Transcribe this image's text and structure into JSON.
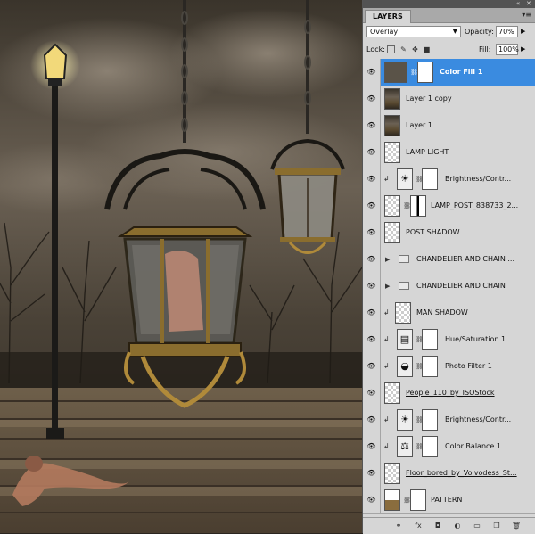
{
  "panel": {
    "tab_label": "LAYERS",
    "menu_icon": "panel-menu-icon",
    "window_controls": [
      "«",
      "✕"
    ],
    "blend_mode": "Overlay",
    "opacity_label": "Opacity:",
    "opacity_value": "70%",
    "lock_label": "Lock:",
    "lock_icons": [
      "lock-transparency-icon",
      "lock-image-icon",
      "lock-position-icon",
      "lock-all-icon"
    ],
    "fill_label": "Fill:",
    "fill_value": "100%"
  },
  "layers": [
    {
      "name": "Color Fill 1",
      "type": "fill",
      "selected": true,
      "clipped": false,
      "underline": false
    },
    {
      "name": "Layer 1 copy",
      "type": "image",
      "selected": false,
      "clipped": false,
      "underline": false
    },
    {
      "name": "Layer 1",
      "type": "image",
      "selected": false,
      "clipped": false,
      "underline": false
    },
    {
      "name": "LAMP LIGHT",
      "type": "pixel",
      "selected": false,
      "clipped": false,
      "underline": false
    },
    {
      "name": "Brightness/Contr...",
      "type": "adjust-brightness",
      "selected": false,
      "clipped": true,
      "underline": false
    },
    {
      "name": "LAMP_POST_838733_2...",
      "type": "smart",
      "selected": false,
      "clipped": false,
      "underline": true
    },
    {
      "name": "POST SHADOW",
      "type": "pixel",
      "selected": false,
      "clipped": false,
      "underline": false
    },
    {
      "name": "CHANDELIER AND CHAIN ...",
      "type": "group",
      "selected": false,
      "clipped": false,
      "underline": false
    },
    {
      "name": "CHANDELIER AND CHAIN",
      "type": "group",
      "selected": false,
      "clipped": false,
      "underline": false
    },
    {
      "name": "MAN SHADOW",
      "type": "pixel",
      "selected": false,
      "clipped": true,
      "underline": false
    },
    {
      "name": "Hue/Saturation 1",
      "type": "adjust-hue",
      "selected": false,
      "clipped": true,
      "underline": false
    },
    {
      "name": "Photo Filter 1",
      "type": "adjust-photo",
      "selected": false,
      "clipped": true,
      "underline": false
    },
    {
      "name": "People_110_by_ISOStock",
      "type": "pixel",
      "selected": false,
      "clipped": false,
      "underline": true
    },
    {
      "name": "Brightness/Contr...",
      "type": "adjust-brightness",
      "selected": false,
      "clipped": true,
      "underline": false
    },
    {
      "name": "Color Balance 1",
      "type": "adjust-balance",
      "selected": false,
      "clipped": true,
      "underline": false
    },
    {
      "name": "Floor_bored_by_Voivodess_St...",
      "type": "pixel",
      "selected": false,
      "clipped": false,
      "underline": true
    },
    {
      "name": "PATTERN",
      "type": "pattern",
      "selected": false,
      "clipped": false,
      "underline": false
    }
  ],
  "bottom_icons": [
    "link-layers-icon",
    "fx-icon",
    "add-mask-icon",
    "adjustment-layer-icon",
    "new-group-icon",
    "new-layer-icon",
    "trash-icon"
  ],
  "bottom_icon_glyphs": [
    "⚭",
    "fx",
    "◘",
    "◐",
    "▭",
    "❐",
    "🗑"
  ],
  "colors": {
    "selection": "#3a8be0",
    "panel_bg": "#d6d6d6",
    "fill_swatch": "#5a5348"
  }
}
